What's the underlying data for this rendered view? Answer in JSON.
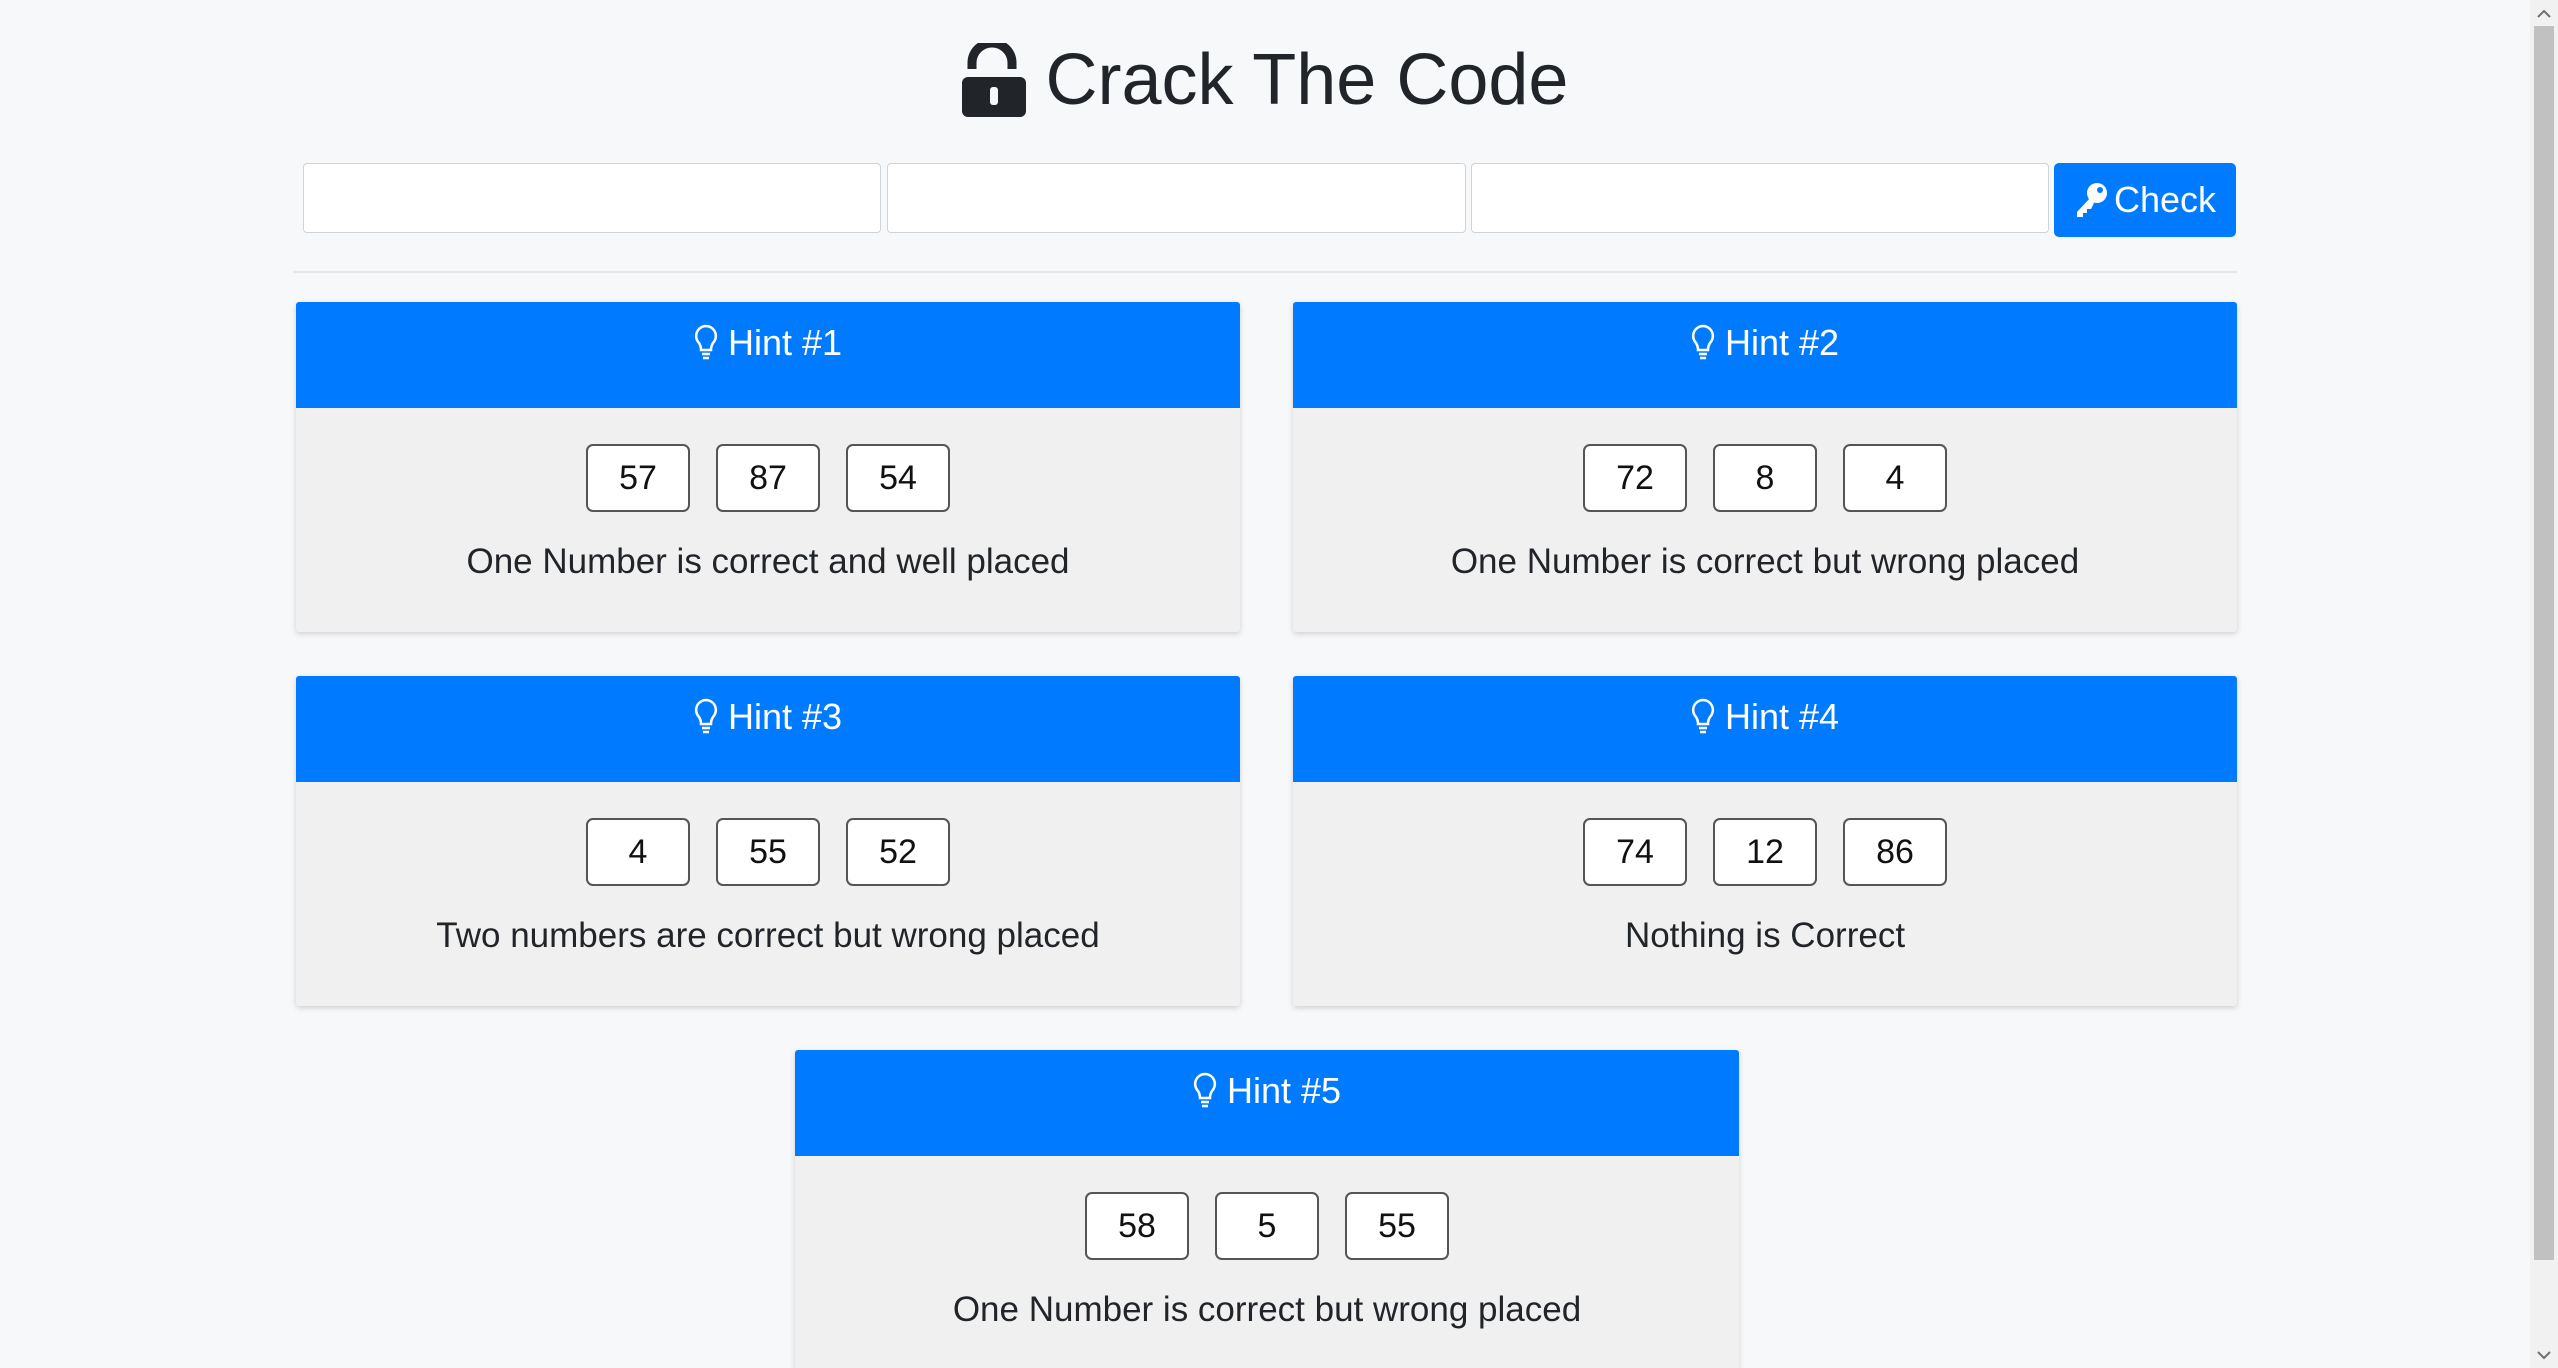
{
  "header": {
    "title": "Crack The Code",
    "icon": "unlock-icon"
  },
  "inputs": [
    {
      "value": "",
      "placeholder": ""
    },
    {
      "value": "",
      "placeholder": ""
    },
    {
      "value": "",
      "placeholder": ""
    }
  ],
  "check_button": {
    "label": "Check",
    "icon": "key-icon"
  },
  "hints": [
    {
      "title": "Hint #1",
      "numbers": [
        "57",
        "87",
        "54"
      ],
      "text": "One Number is correct and well placed"
    },
    {
      "title": "Hint #2",
      "numbers": [
        "72",
        "8",
        "4"
      ],
      "text": "One Number is correct but wrong placed"
    },
    {
      "title": "Hint #3",
      "numbers": [
        "4",
        "55",
        "52"
      ],
      "text": "Two numbers are correct but wrong placed"
    },
    {
      "title": "Hint #4",
      "numbers": [
        "74",
        "12",
        "86"
      ],
      "text": "Nothing is Correct"
    },
    {
      "title": "Hint #5",
      "numbers": [
        "58",
        "5",
        "55"
      ],
      "text": "One Number is correct but wrong placed"
    }
  ],
  "colors": {
    "primary": "#007bff",
    "card_body": "#f0f0f0",
    "background": "#f7f8fa"
  }
}
